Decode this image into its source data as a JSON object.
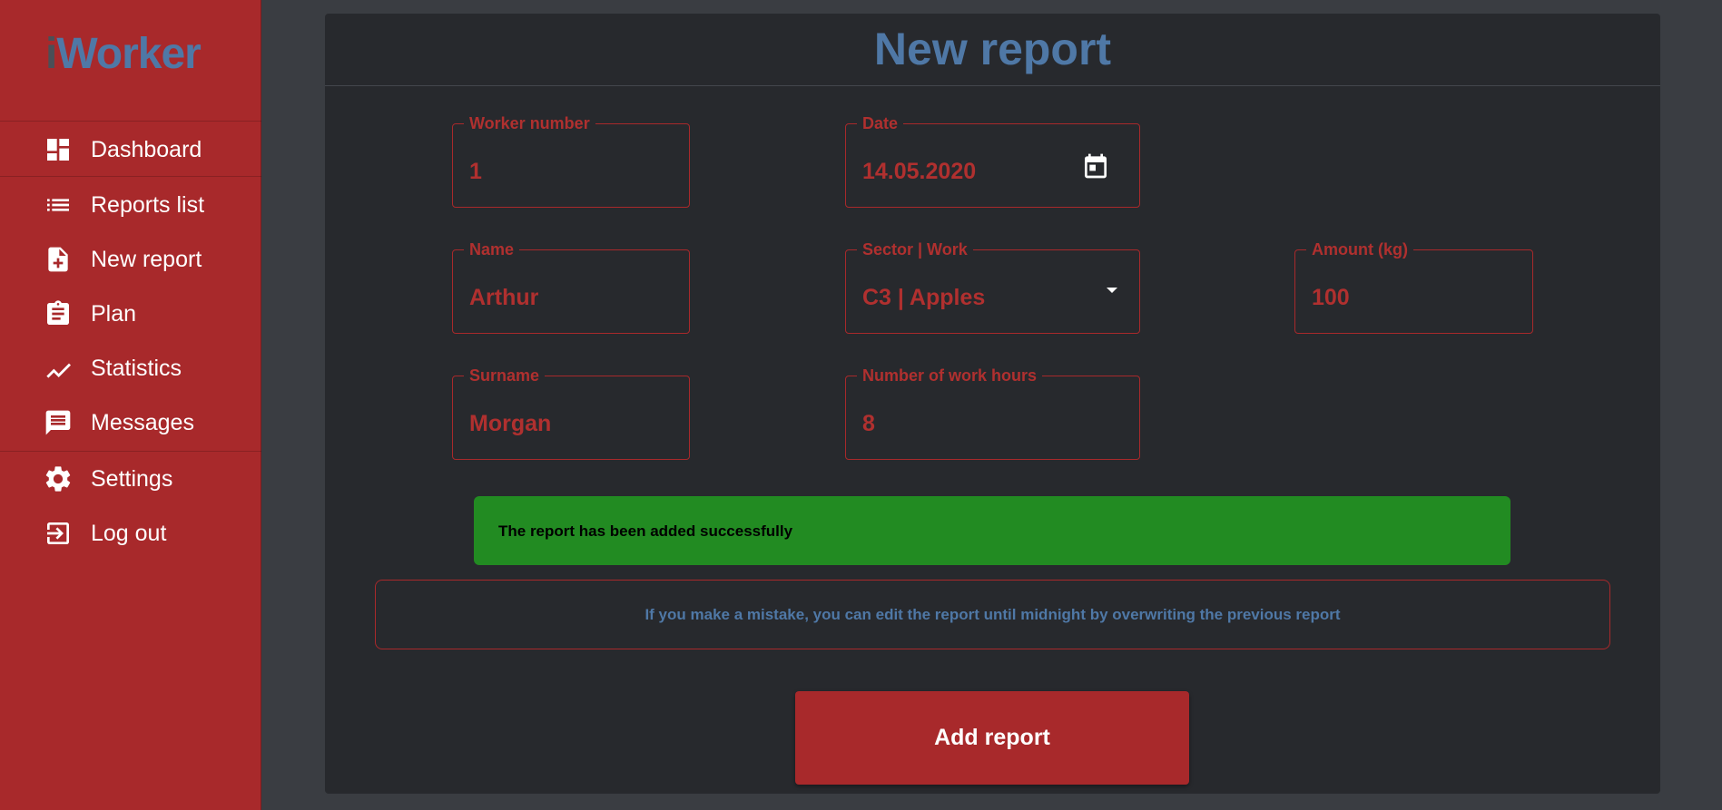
{
  "app": {
    "logo_i": "i",
    "logo_rest": "Worker"
  },
  "sidebar": {
    "items": [
      {
        "label": "Dashboard",
        "icon": "dashboard-icon"
      },
      {
        "label": "Reports list",
        "icon": "list-icon"
      },
      {
        "label": "New report",
        "icon": "note-add-icon"
      },
      {
        "label": "Plan",
        "icon": "clipboard-icon"
      },
      {
        "label": "Statistics",
        "icon": "trending-up-icon"
      },
      {
        "label": "Messages",
        "icon": "message-icon"
      },
      {
        "label": "Settings",
        "icon": "gear-icon"
      },
      {
        "label": "Log out",
        "icon": "logout-icon"
      }
    ]
  },
  "page": {
    "title": "New report"
  },
  "form": {
    "worker_number": {
      "label": "Worker number",
      "value": "1"
    },
    "date": {
      "label": "Date",
      "value": "14.05.2020"
    },
    "name": {
      "label": "Name",
      "value": "Arthur"
    },
    "sector": {
      "label": "Sector | Work",
      "value": "C3 | Apples"
    },
    "amount": {
      "label": "Amount (kg)",
      "value": "100"
    },
    "surname": {
      "label": "Surname",
      "value": "Morgan"
    },
    "hours": {
      "label": "Number of work hours",
      "value": "8"
    }
  },
  "success_message": "The report has been added successfully",
  "hint": "If you make a mistake, you can edit the report until midnight by overwriting the previous report",
  "submit_label": "Add report",
  "colors": {
    "sidebar": "#a8292b",
    "accent_blue": "#4f78a6",
    "success": "#228b22",
    "card": "#27292d",
    "background": "#3a3d42"
  }
}
